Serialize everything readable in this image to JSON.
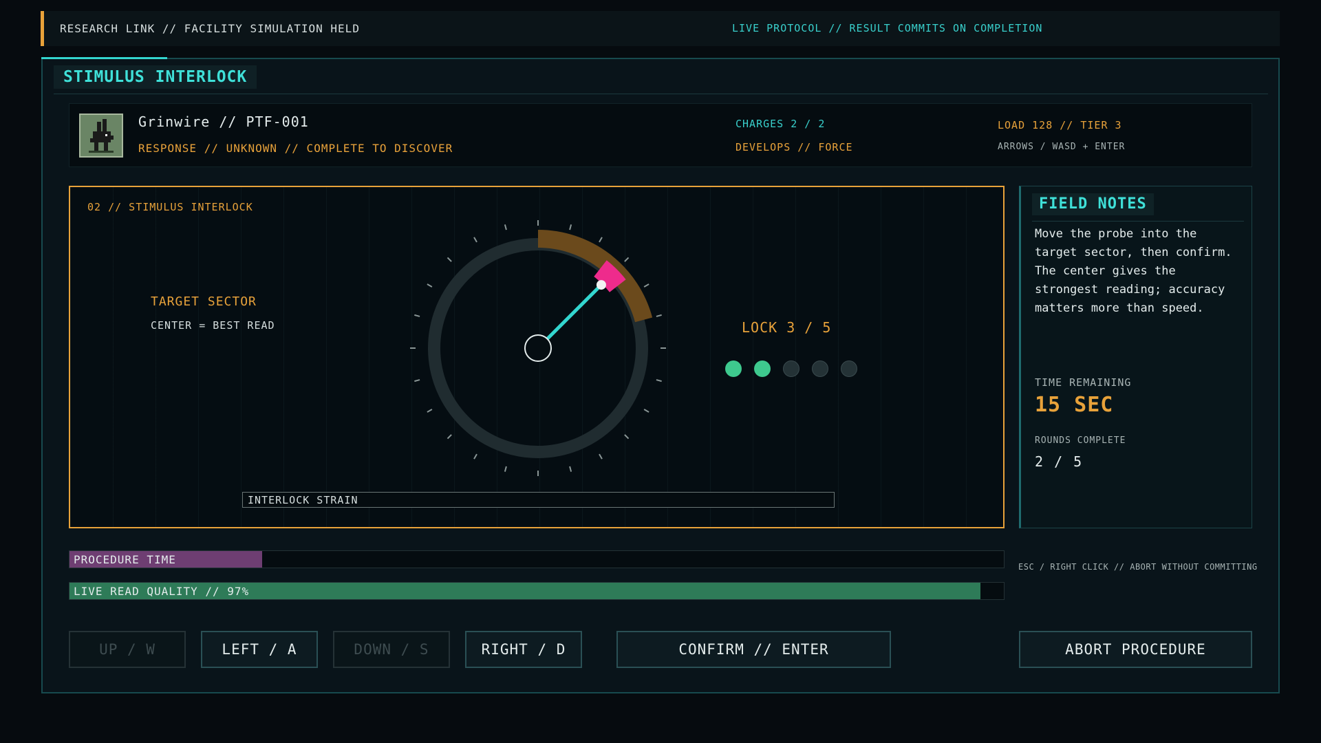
{
  "topbar": {
    "left_text": "RESEARCH LINK // FACILITY SIMULATION HELD",
    "right_text": "LIVE PROTOCOL // RESULT COMMITS ON COMPLETION"
  },
  "panel": {
    "title": "STIMULUS INTERLOCK"
  },
  "creature": {
    "name": "Grinwire // PTF-001",
    "response": "RESPONSE // UNKNOWN // COMPLETE TO DISCOVER",
    "charges": "CHARGES 2 / 2",
    "develops": "DEVELOPS // FORCE",
    "load": "LOAD 128 // TIER 3",
    "controls": "ARROWS / WASD + ENTER"
  },
  "arena": {
    "label": "02 // STIMULUS INTERLOCK",
    "target_title": "TARGET SECTOR",
    "target_sub": "CENTER = BEST READ",
    "lock_label": "LOCK 3 / 5",
    "lock_progress": 2,
    "lock_total": 5,
    "strain_label": "INTERLOCK STRAIN",
    "strain_level": 0,
    "target_sector_deg": [
      0,
      75
    ],
    "probe_angle_deg": 45
  },
  "notes": {
    "title": "FIELD NOTES",
    "text": "Move the probe into the target sector, then confirm. The center gives the strongest reading; accuracy matters more than speed.",
    "time_label": "TIME REMAINING",
    "time_value": "15 SEC",
    "rounds_label": "ROUNDS COMPLETE",
    "rounds_value": "2 / 5"
  },
  "bars": {
    "procedure_label": "PROCEDURE TIME",
    "procedure_fraction": 0.206,
    "quality_label": "LIVE READ QUALITY // 97%",
    "quality_fraction": 0.975,
    "abort_hint": "ESC / RIGHT CLICK // ABORT WITHOUT COMMITTING"
  },
  "buttons": {
    "up": "UP / W",
    "left": "LEFT / A",
    "down": "DOWN / S",
    "right": "RIGHT / D",
    "confirm": "CONFIRM // ENTER",
    "abort": "ABORT PROCEDURE"
  },
  "colors": {
    "accent_cyan": "#33d6cf",
    "accent_amber": "#e8a23a",
    "probe_magenta": "#ee2b8c",
    "sector_brown": "#6b4a1c",
    "quality_green": "#2e7b58",
    "time_purple": "#6e3e72"
  }
}
